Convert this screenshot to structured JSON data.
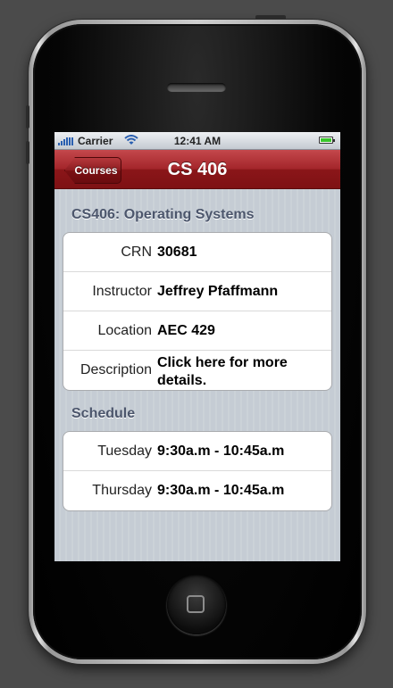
{
  "status_bar": {
    "carrier": "Carrier",
    "time": "12:41 AM",
    "wifi_icon": "wifi-icon",
    "battery_icon": "battery-icon"
  },
  "nav": {
    "back_label": "Courses",
    "title": "CS 406"
  },
  "course": {
    "section_title": "CS406: Operating Systems",
    "rows": [
      {
        "label": "CRN",
        "value": "30681"
      },
      {
        "label": "Instructor",
        "value": "Jeffrey Pfaffmann"
      },
      {
        "label": "Location",
        "value": "AEC 429"
      },
      {
        "label": "Description",
        "value": "Click here for more details."
      }
    ]
  },
  "schedule": {
    "section_title": "Schedule",
    "rows": [
      {
        "label": "Tuesday",
        "value": "9:30a.m - 10:45a.m"
      },
      {
        "label": "Thursday",
        "value": "9:30a.m - 10:45a.m"
      }
    ]
  },
  "colors": {
    "nav_bar": "#8b1619",
    "section_text": "#4c566c",
    "background": "#c5ccd4"
  }
}
